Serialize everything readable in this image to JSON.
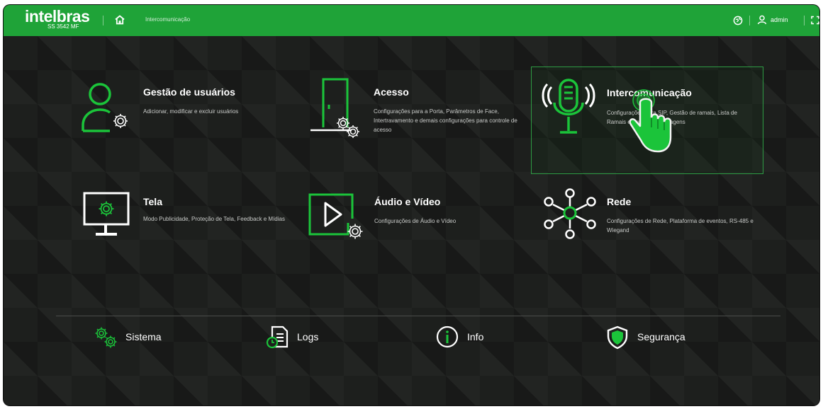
{
  "header": {
    "brand": "intelbras",
    "model": "SS 3542 MF",
    "breadcrumb": "Intercomunicação",
    "username": "admin",
    "home_icon": "home-icon",
    "language_icon": "globe-icon",
    "user_icon": "user-icon",
    "fullscreen_icon": "fullscreen-icon"
  },
  "colors": {
    "brand_green": "#1fa338",
    "icon_green": "#1bc43a",
    "background": "#1d1f1d"
  },
  "modules": [
    {
      "title": "Gestão de usuários",
      "desc": "Adicionar, modificar e excluir usuários",
      "icon": "user-gear-icon"
    },
    {
      "title": "Acesso",
      "desc": "Configurações para a Porta, Parâmetros de Face, Intertravamento e demais configurações para controle de acesso",
      "icon": "door-gear-icon"
    },
    {
      "title": "Intercomunicação",
      "desc": "Configurações para SIP, Gestão de ramais, Lista de Ramais e Envio de mensagens",
      "icon": "microphone-icon",
      "selected": true
    },
    {
      "title": "Tela",
      "desc": "Modo Publicidade, Proteção de Tela, Feedback e Mídias",
      "icon": "monitor-gear-icon"
    },
    {
      "title": "Áudio e Vídeo",
      "desc": "Configurações de Áudio e Vídeo",
      "icon": "play-gear-icon"
    },
    {
      "title": "Rede",
      "desc": "Configurações de Rede, Plataforma de eventos, RS-485 e Wiegand",
      "icon": "network-icon"
    }
  ],
  "bottom": [
    {
      "label": "Sistema",
      "icon": "gears-icon"
    },
    {
      "label": "Logs",
      "icon": "log-file-icon"
    },
    {
      "label": "Info",
      "icon": "info-icon"
    },
    {
      "label": "Segurança",
      "icon": "shield-icon"
    }
  ]
}
